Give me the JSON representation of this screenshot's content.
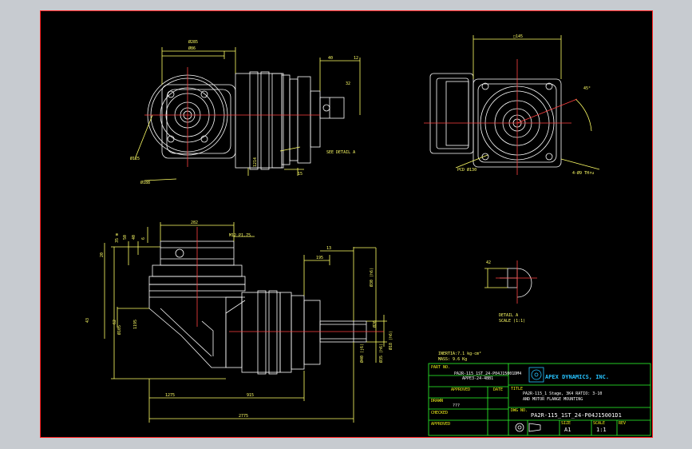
{
  "drawing": {
    "top_view": {
      "dims": [
        "Ø285",
        "Ø86",
        "Ø125",
        "Ø188",
        "1214",
        "15",
        "40",
        "12",
        "32"
      ],
      "note": "SEE DETAIL A"
    },
    "side_view": {
      "dims": [
        "□145",
        "45°",
        "4-Ø9 THru",
        "PCD Ø130"
      ]
    },
    "front_view": {
      "dims": [
        "282",
        "M12 P1.75",
        "35 m",
        "50",
        "40",
        "6",
        "20",
        "62",
        "43",
        "1275",
        "915",
        "195",
        "13",
        "Ø30 (h6)",
        "Ø35 (h6)",
        "Ø18 (h6)",
        "Ø40 (j6)",
        "Ø26",
        "1195",
        "2775",
        "Ø105"
      ],
      "inertia": "INERTIA:7.1 kg-cm²",
      "mass": "MASS: 9.6 Kg"
    },
    "detail": {
      "dim": "42",
      "label": "DETAIL A",
      "scale": "SCALE (1:1)"
    }
  },
  "title_block": {
    "part_no_label": "PART NO.",
    "part_no_line1": "PA2R-115_1ST_24-P04J15001DM4",
    "part_no_line2": "APPE3-24-4BB1",
    "approved_label": "APPROVED",
    "date_label": "DATE",
    "drawn_label": "DRAWN",
    "drawn_value": "???",
    "checked_label": "CHECKED",
    "approved2_label": "APPROVED",
    "title_label": "TITLE",
    "title_line1": "PA2R-115_1 Stage, 3K4  RATIO: 3-10",
    "title_line2": "AND MOTOR FLANGE MOUNTING",
    "company": "APEX DYNAMICS, INC.",
    "dwg_no_label": "DWG NO.",
    "dwg_no": "PA2R-115_1ST_24-P04J15001D1",
    "size_label": "SIZE",
    "size_value": "A1",
    "scale_label": "SCALE",
    "scale_value": "1:1",
    "rev_label": "REV"
  }
}
